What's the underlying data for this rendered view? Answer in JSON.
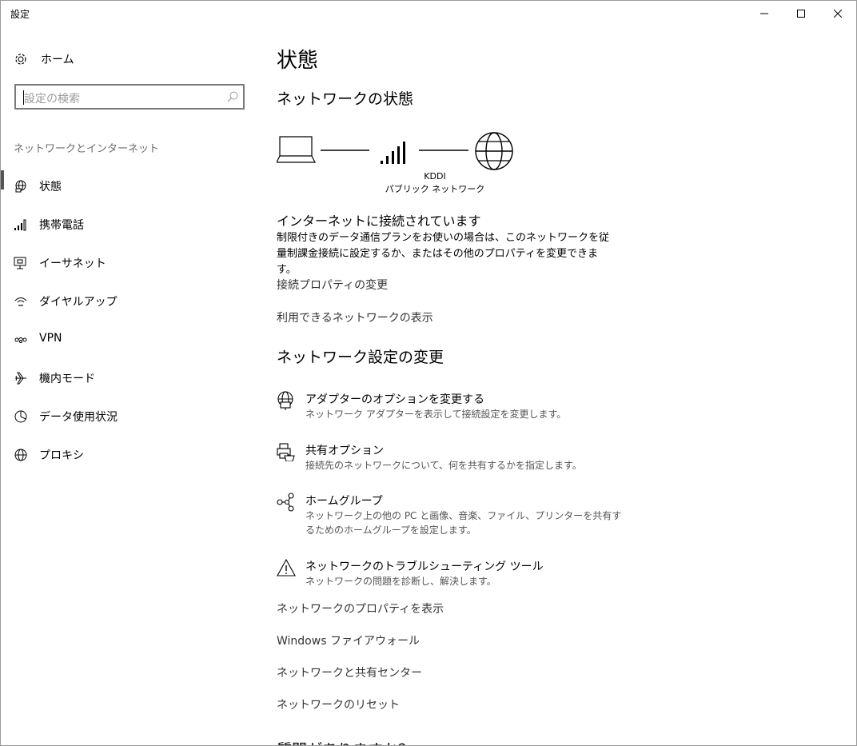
{
  "window": {
    "title": "設定"
  },
  "sidebar": {
    "home_label": "ホーム",
    "search_placeholder": "設定の検索",
    "section_label": "ネットワークとインターネット",
    "items": [
      {
        "label": "状態",
        "icon": "globe-status-icon",
        "active": true
      },
      {
        "label": "携帯電話",
        "icon": "cellular-signal-icon"
      },
      {
        "label": "イーサネット",
        "icon": "ethernet-icon"
      },
      {
        "label": "ダイヤルアップ",
        "icon": "dialup-icon"
      },
      {
        "label": "VPN",
        "icon": "vpn-icon"
      },
      {
        "label": "機内モード",
        "icon": "airplane-icon"
      },
      {
        "label": "データ使用状況",
        "icon": "data-usage-icon"
      },
      {
        "label": "プロキシ",
        "icon": "globe-icon"
      }
    ]
  },
  "main": {
    "title": "状態",
    "network_status_heading": "ネットワークの状態",
    "network": {
      "name": "KDDI",
      "type": "パブリック ネットワーク"
    },
    "connection_status": "インターネットに接続されています",
    "connection_desc": "制限付きのデータ通信プランをお使いの場合は、このネットワークを従量制課金接続に設定するか、またはその他のプロパティを変更できます。",
    "links1": [
      "接続プロパティの変更",
      "利用できるネットワークの表示"
    ],
    "change_settings_heading": "ネットワーク設定の変更",
    "options": [
      {
        "title": "アダプターのオプションを変更する",
        "desc": "ネットワーク アダプターを表示して接続設定を変更します。",
        "icon": "adapter-icon"
      },
      {
        "title": "共有オプション",
        "desc": "接続先のネットワークについて、何を共有するかを指定します。",
        "icon": "sharing-icon"
      },
      {
        "title": "ホームグループ",
        "desc": "ネットワーク上の他の PC と画像、音楽、ファイル、プリンターを共有するためのホームグループを設定します。",
        "icon": "homegroup-icon"
      },
      {
        "title": "ネットワークのトラブルシューティング ツール",
        "desc": "ネットワークの問題を診断し、解決します。",
        "icon": "warning-icon"
      }
    ],
    "links2": [
      "ネットワークのプロパティを表示",
      "Windows ファイアウォール",
      "ネットワークと共有センター",
      "ネットワークのリセット"
    ],
    "cut_heading": "質問がありますか？"
  }
}
